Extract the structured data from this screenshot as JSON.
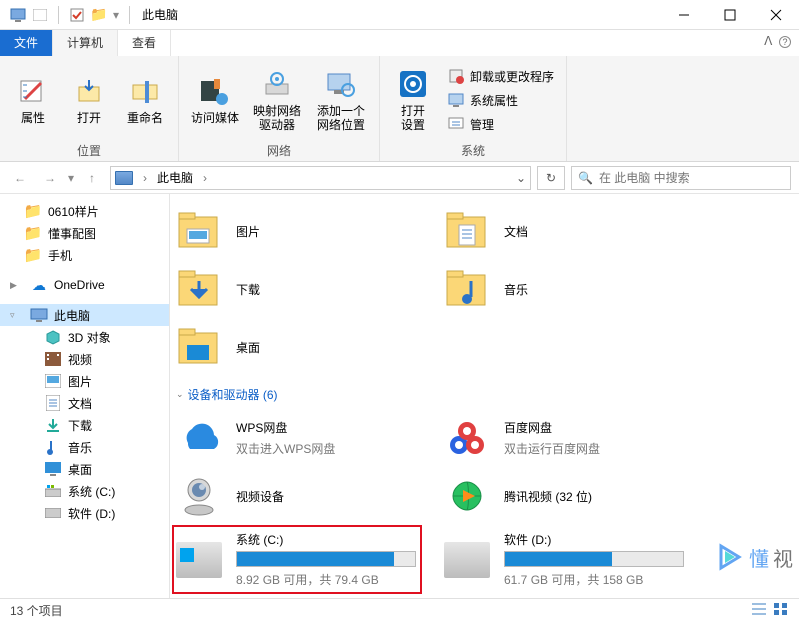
{
  "window": {
    "title": "此电脑",
    "min": "—",
    "max": "□",
    "close": "✕"
  },
  "tabs": {
    "file": "文件",
    "computer": "计算机",
    "view": "查看"
  },
  "ribbon": {
    "loc": {
      "prop": "属性",
      "open": "打开",
      "rename": "重命名",
      "group": "位置"
    },
    "net": {
      "media": "访问媒体",
      "mapdrv": "映射网络\n驱动器",
      "addloc": "添加一个\n网络位置",
      "group": "网络"
    },
    "sys": {
      "settings": "打开\n设置",
      "uninstall": "卸载或更改程序",
      "sysprop": "系统属性",
      "manage": "管理",
      "group": "系统"
    }
  },
  "nav": {
    "location": "此电脑",
    "search_placeholder": "在 此电脑 中搜索"
  },
  "sidebar": {
    "items": [
      {
        "label": "0610样片",
        "type": "folder"
      },
      {
        "label": "懂事配图",
        "type": "folder"
      },
      {
        "label": "手机",
        "type": "folder"
      },
      {
        "label": "OneDrive",
        "type": "cloud"
      },
      {
        "label": "此电脑",
        "type": "pc",
        "selected": true,
        "exp": true
      },
      {
        "label": "3D 对象",
        "type": "obj",
        "indent": true
      },
      {
        "label": "视频",
        "type": "video",
        "indent": true
      },
      {
        "label": "图片",
        "type": "pic",
        "indent": true
      },
      {
        "label": "文档",
        "type": "doc",
        "indent": true
      },
      {
        "label": "下载",
        "type": "dl",
        "indent": true
      },
      {
        "label": "音乐",
        "type": "music",
        "indent": true
      },
      {
        "label": "桌面",
        "type": "desk",
        "indent": true
      },
      {
        "label": "系统 (C:)",
        "type": "drive",
        "indent": true
      },
      {
        "label": "软件 (D:)",
        "type": "drive",
        "indent": true
      }
    ]
  },
  "content": {
    "libs": [
      {
        "label": "图片"
      },
      {
        "label": "文档"
      },
      {
        "label": "下载"
      },
      {
        "label": "音乐"
      },
      {
        "label": "桌面"
      }
    ],
    "section": "设备和驱动器 (6)",
    "drives": [
      {
        "title": "WPS网盘",
        "sub": "双击进入WPS网盘"
      },
      {
        "title": "百度网盘",
        "sub": "双击运行百度网盘"
      },
      {
        "title": "视频设备",
        "sub": ""
      },
      {
        "title": "腾讯视频 (32 位)",
        "sub": ""
      },
      {
        "title": "系统 (C:)",
        "sub": "8.92 GB 可用，共 79.4 GB",
        "pct": 88,
        "highlight": true,
        "win": true
      },
      {
        "title": "软件 (D:)",
        "sub": "61.7 GB 可用，共 158 GB",
        "pct": 60
      }
    ]
  },
  "status": {
    "count": "13 个项目"
  },
  "watermark": {
    "a": "懂",
    "b": "视"
  }
}
